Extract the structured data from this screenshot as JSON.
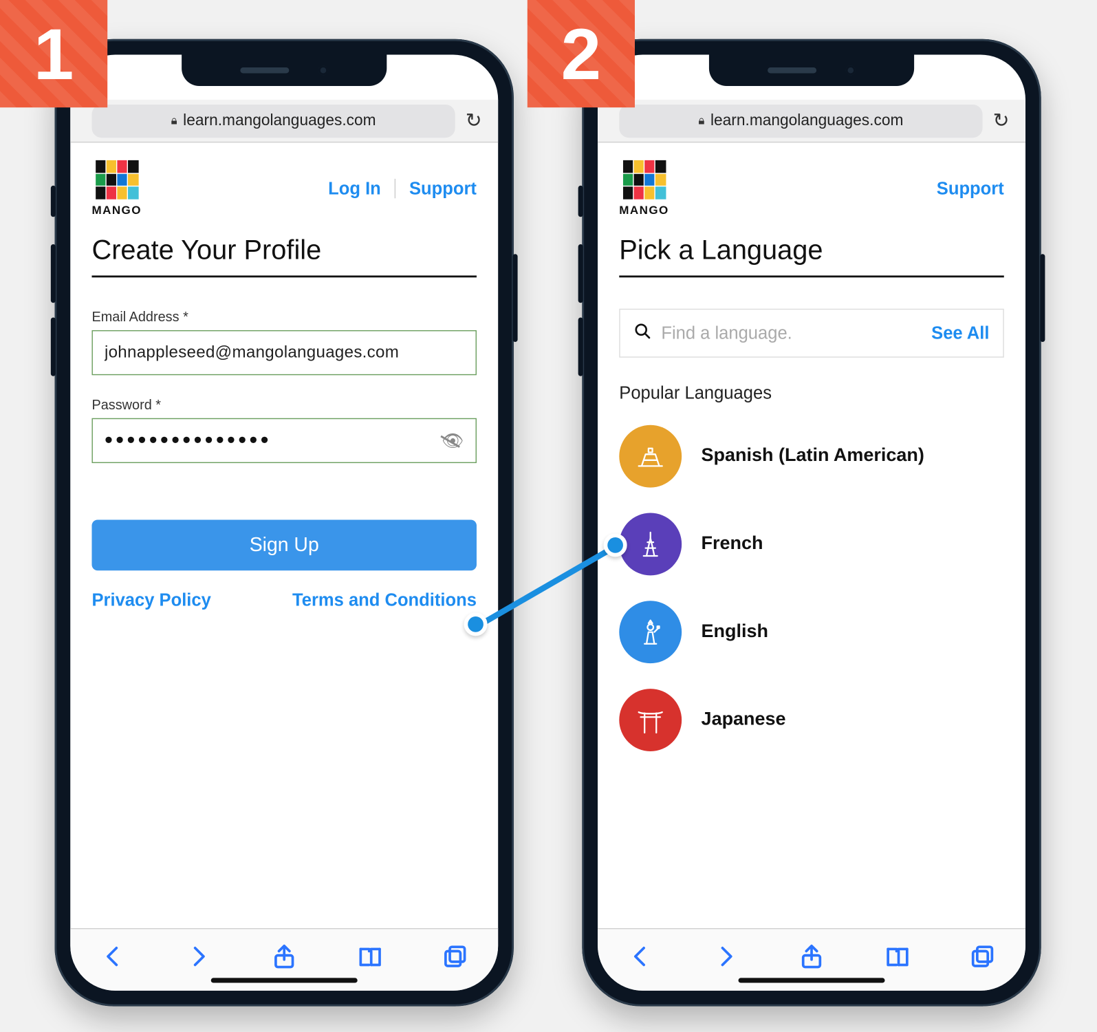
{
  "steps": {
    "one": "1",
    "two": "2"
  },
  "browser": {
    "host": "learn.mangolanguages.com"
  },
  "brand": {
    "name": "MANGO"
  },
  "header": {
    "login": "Log In",
    "support": "Support"
  },
  "screen1": {
    "title": "Create Your Profile",
    "email_label": "Email Address *",
    "email_value": "johnappleseed@mangolanguages.com",
    "password_label": "Password *",
    "password_masked": "•••••••••••••••",
    "signup": "Sign Up",
    "privacy": "Privacy Policy",
    "terms": "Terms and Conditions"
  },
  "screen2": {
    "title": "Pick a Language",
    "search_placeholder": "Find a language.",
    "see_all": "See All",
    "section": "Popular Languages",
    "languages": [
      {
        "name": "Spanish (Latin American)",
        "color": "orange",
        "icon": "pyramid"
      },
      {
        "name": "French",
        "color": "purple",
        "icon": "eiffel"
      },
      {
        "name": "English",
        "color": "blue",
        "icon": "liberty"
      },
      {
        "name": "Japanese",
        "color": "red",
        "icon": "torii"
      }
    ]
  }
}
